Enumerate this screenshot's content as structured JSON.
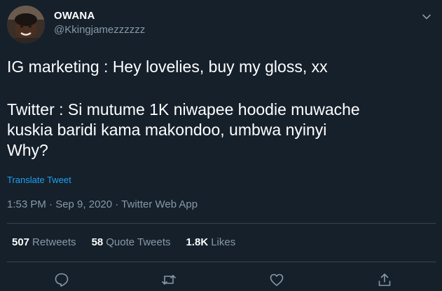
{
  "tweet": {
    "author": {
      "display_name": "OWANA",
      "handle": "@Kkingjamezzzzzz"
    },
    "text": {
      "line1": "IG marketing : Hey lovelies, buy my gloss, xx",
      "line2": "Twitter : Si mutume 1K niwapee hoodie muwache",
      "line3": "kuskia baridi kama makondoo, umbwa nyinyi",
      "line4": "Why?"
    },
    "translate_label": "Translate Tweet",
    "timestamp": "1:53 PM · Sep 9, 2020 · Twitter Web App",
    "stats": {
      "retweets_count": "507",
      "retweets_label": "Retweets",
      "quotes_count": "58",
      "quotes_label": "Quote Tweets",
      "likes_count": "1.8K",
      "likes_label": "Likes"
    },
    "icons": {
      "more": "chevron-down-icon",
      "reply": "reply-icon",
      "retweet": "retweet-icon",
      "like": "heart-icon",
      "share": "share-icon"
    }
  },
  "colors": {
    "background": "#15202b",
    "text_primary": "#ffffff",
    "text_secondary": "#8899a6",
    "link": "#1da1f2",
    "divider": "#38444d"
  }
}
